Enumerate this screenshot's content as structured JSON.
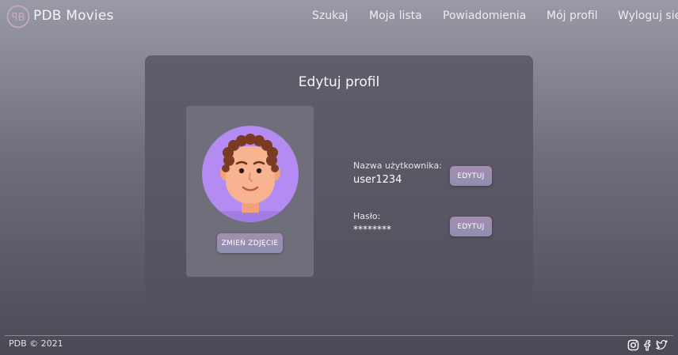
{
  "app": {
    "brand": "PDB Movies"
  },
  "nav": {
    "search": "Szukaj",
    "my_list": "Moja lista",
    "notifications": "Powiadomienia",
    "my_profile": "Mój profil",
    "logout": "Wyloguj się"
  },
  "card": {
    "title": "Edytuj profil",
    "change_photo_label": "ZMIEŃ ZDJĘCIE",
    "username_label": "Nazwa użytkownika:",
    "username_value": "user1234",
    "password_label": "Hasło:",
    "password_value": "********",
    "edit_label": "EDYTUJ"
  },
  "footer": {
    "copyright": "PDB © 2021"
  },
  "colors": {
    "accent_button": "#a58db0",
    "avatar_bg": "#b48bf2",
    "card_bg": "#5f5e6a"
  },
  "icons": {
    "logo": "pdb-logo-icon",
    "avatar": "user-avatar-illustration",
    "instagram": "instagram-icon",
    "facebook": "facebook-icon",
    "twitter": "twitter-icon"
  }
}
